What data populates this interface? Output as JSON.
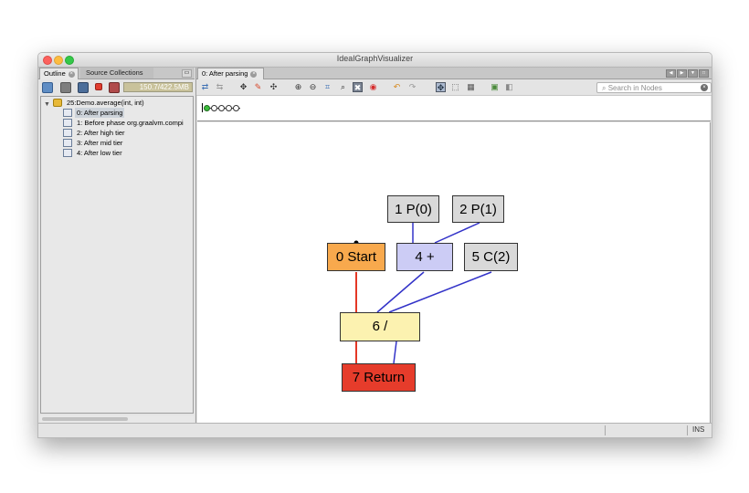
{
  "window": {
    "title": "IdealGraphVisualizer"
  },
  "left_panel": {
    "tabs": [
      {
        "label": "Outline"
      },
      {
        "label": "Source Collections"
      }
    ],
    "memory": "150.7/422.5MB",
    "tree": {
      "root": "25:Demo.average(int, int)",
      "items": [
        {
          "label": "0: After parsing",
          "selected": true
        },
        {
          "label": "1: Before phase org.graalvm.compi"
        },
        {
          "label": "2: After high tier"
        },
        {
          "label": "3: After mid tier"
        },
        {
          "label": "4: After low tier"
        }
      ]
    }
  },
  "editor": {
    "tab_label": "0: After parsing",
    "search_placeholder": "Search in Nodes",
    "toolbar_icons": [
      "expand-icon",
      "reduce-icon",
      "center-icon",
      "hide-icon",
      "show-icon",
      "zoom-in-icon",
      "zoom-out-icon",
      "hierarchy-icon",
      "zoom-fit-icon",
      "close-up-icon",
      "panorama-icon",
      "undo-icon",
      "redo-icon",
      "pan-mode-icon",
      "select-mode-icon",
      "overview-icon",
      "export-icon",
      "import-icon"
    ]
  },
  "graph": {
    "nodes": [
      {
        "id": "n1",
        "label": "1 P(0)",
        "color": "#d9d9d9"
      },
      {
        "id": "n2",
        "label": "2 P(1)",
        "color": "#d9d9d9"
      },
      {
        "id": "n0",
        "label": "0 Start",
        "color": "#f8a94d"
      },
      {
        "id": "n4",
        "label": "4 +",
        "color": "#ccccf5"
      },
      {
        "id": "n5",
        "label": "5 C(2)",
        "color": "#d9d9d9"
      },
      {
        "id": "n6",
        "label": "6 /",
        "color": "#fcf2b0"
      },
      {
        "id": "n7",
        "label": "7 Return",
        "color": "#e63c2b"
      }
    ],
    "edge_colors": {
      "data": "#3232c8",
      "control": "#e43725"
    }
  },
  "status": {
    "insert_mode": "INS"
  },
  "colors": {
    "selection": "#cdd3da",
    "window_bg": "#e4e4e4"
  }
}
